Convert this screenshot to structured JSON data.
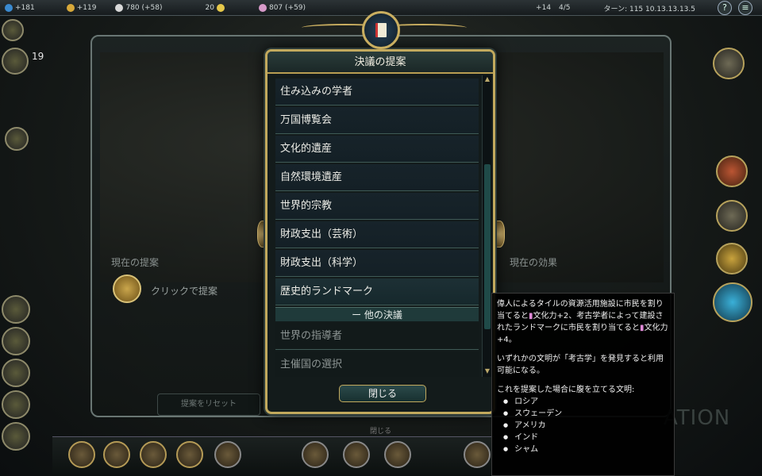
{
  "topbar": {
    "science": "+181",
    "gold": "+119",
    "faith": "780 (+58)",
    "happy": "20",
    "culture": "807 (+59)",
    "tourism": "+14",
    "policies": "4/5",
    "turn": "ターン: 115  10.13.13.13.5"
  },
  "left": {
    "happy_count": "19"
  },
  "background_panel": {
    "current_proposal_label": "現在の提案",
    "click_to_propose": "クリックで提案",
    "current_effect_label": "現在の効果",
    "reset_button": "提案をリセット",
    "close": "閉じる",
    "watermark": "ATION"
  },
  "modal": {
    "title": "決議の提案",
    "items": [
      {
        "label": "住み込みの学者"
      },
      {
        "label": "万国博覧会"
      },
      {
        "label": "文化的遺産"
      },
      {
        "label": "自然環境遺産"
      },
      {
        "label": "世界的宗教"
      },
      {
        "label": "財政支出（芸術）"
      },
      {
        "label": "財政支出（科学）"
      },
      {
        "label": "歴史的ランドマーク"
      }
    ],
    "section": "ー 他の決議",
    "other_items": [
      {
        "label": "世界の指導者"
      },
      {
        "label": "主催国の選択"
      }
    ],
    "close_button": "閉じる"
  },
  "tooltip": {
    "line1": "偉人によるタイルの資源活用施設に市民を割り当てると",
    "culture1": "文化力+2、考古学者によって建設されたランドマークに市民を割り当てると",
    "culture2": "文化力+4。",
    "para2": "いずれかの文明が「考古学」を発見すると利用可能になる。",
    "para3": "これを提案した場合に腹を立てる文明:",
    "civs": [
      "ロシア",
      "スウェーデン",
      "アメリカ",
      "インド",
      "シャム"
    ]
  },
  "colors": {
    "frame_gold": "#c2a95d",
    "panel_teal": "#1f3a3a",
    "culture_pink": "#e08ad8"
  }
}
